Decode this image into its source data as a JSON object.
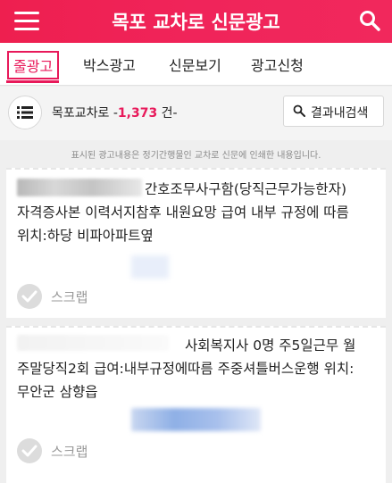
{
  "header": {
    "title_prefix": "목포 ",
    "title_brand": "교차로",
    "title_suffix": " 신문광고"
  },
  "tabs": [
    {
      "label": "줄광고",
      "active": true
    },
    {
      "label": "박스광고"
    },
    {
      "label": "신문보기"
    },
    {
      "label": "광고신청"
    }
  ],
  "countbar": {
    "prefix": "목포교차로 -",
    "count": "1,373",
    "suffix": " 건-",
    "result_button": "결과내검색"
  },
  "notice": "표시된 광고내용은 정기간행물인 교차로 신문에 인쇄한 내용입니다.",
  "listings": [
    {
      "line1": "간호조무사구함(당직근무가능한자)",
      "line2": "자격증사본 이력서지참후 내원요망 급여 내부 규정에 따름",
      "line3": "위치:하당 비파아파트옆",
      "scrap": "스크랩"
    },
    {
      "line1": "사회복지사 0명 주5일근무 월",
      "line2": "주말당직2회 급여:내부규정에따름 주중셔틀버스운행 위치:",
      "line3": "무안군 삼향읍",
      "scrap": "스크랩"
    }
  ],
  "colors": {
    "accent": "#e8195a",
    "header": "#ef2152"
  },
  "icons": {
    "menu": "hamburger-icon",
    "search": "search-icon",
    "list": "list-icon",
    "scrap": "check-icon"
  }
}
